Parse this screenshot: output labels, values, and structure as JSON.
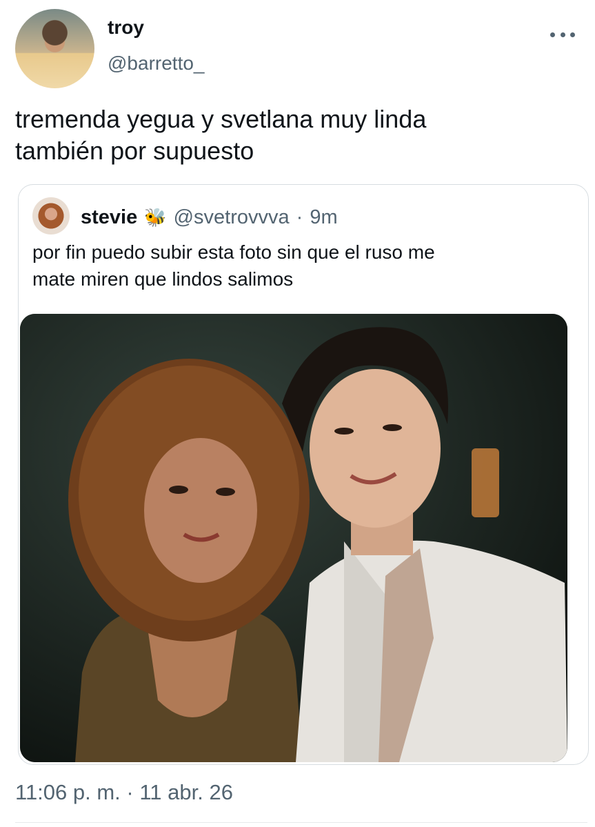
{
  "tweet": {
    "author": {
      "name": "troy",
      "handle": "@barretto_"
    },
    "text": "tremenda yegua y svetlana muy linda\ntambién por supuesto",
    "timestamp": "11:06 p. m. · 11 abr. 26",
    "more_icon": "more-horizontal-icon"
  },
  "quoted": {
    "author": {
      "name": "stevie",
      "emoji": "🐝",
      "handle": "@svetrovvva",
      "separator": "·",
      "time": "9m"
    },
    "text": "por fin puedo subir esta foto sin que el ruso me\nmate miren que lindos salimos"
  },
  "colors": {
    "text": "#0f1419",
    "secondary": "#536471",
    "border": "#d6dce0"
  }
}
